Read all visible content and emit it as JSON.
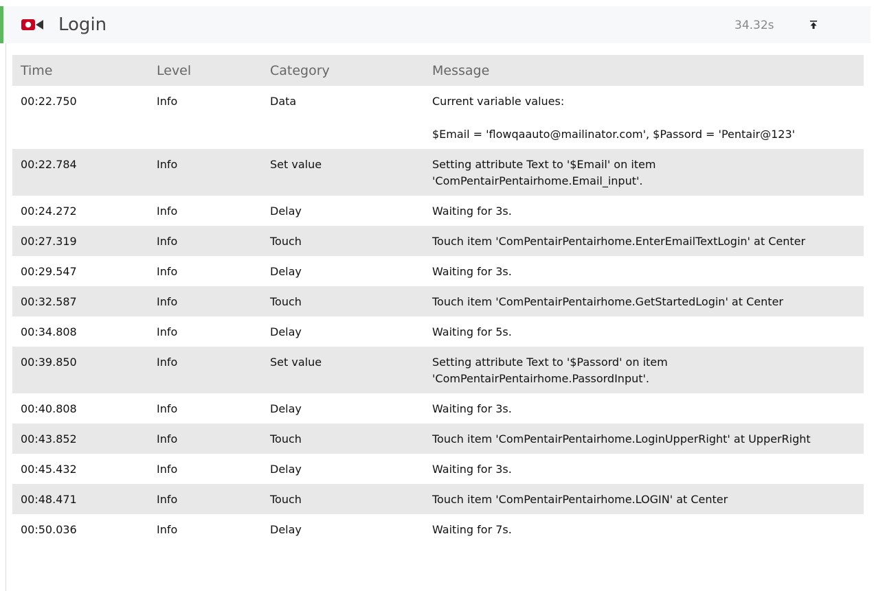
{
  "header": {
    "icon": "video-record-icon",
    "title": "Login",
    "duration": "34.32s",
    "scroll_top_icon": "scroll-to-top-icon",
    "accent_color": "#5cb85c",
    "record_color": "#c9001f"
  },
  "table": {
    "columns": [
      "Time",
      "Level",
      "Category",
      "Message"
    ],
    "rows": [
      {
        "time": "00:22.750",
        "level": "Info",
        "category": "Data",
        "message": "Current variable values:",
        "message_extra": "$Email = 'flowqaauto@mailinator.com', $Passord = 'Pentair@123'"
      },
      {
        "time": "00:22.784",
        "level": "Info",
        "category": "Set value",
        "message": "Setting attribute Text to '$Email' on item 'ComPentairPentairhome.Email_input'."
      },
      {
        "time": "00:24.272",
        "level": "Info",
        "category": "Delay",
        "message": "Waiting for 3s."
      },
      {
        "time": "00:27.319",
        "level": "Info",
        "category": "Touch",
        "message": "Touch item 'ComPentairPentairhome.EnterEmailTextLogin' at Center"
      },
      {
        "time": "00:29.547",
        "level": "Info",
        "category": "Delay",
        "message": "Waiting for 3s."
      },
      {
        "time": "00:32.587",
        "level": "Info",
        "category": "Touch",
        "message": "Touch item 'ComPentairPentairhome.GetStartedLogin' at Center"
      },
      {
        "time": "00:34.808",
        "level": "Info",
        "category": "Delay",
        "message": "Waiting for 5s."
      },
      {
        "time": "00:39.850",
        "level": "Info",
        "category": "Set value",
        "message": "Setting attribute Text to '$Passord' on item 'ComPentairPentairhome.PassordInput'."
      },
      {
        "time": "00:40.808",
        "level": "Info",
        "category": "Delay",
        "message": "Waiting for 3s."
      },
      {
        "time": "00:43.852",
        "level": "Info",
        "category": "Touch",
        "message": "Touch item 'ComPentairPentairhome.LoginUpperRight' at UpperRight"
      },
      {
        "time": "00:45.432",
        "level": "Info",
        "category": "Delay",
        "message": "Waiting for 3s."
      },
      {
        "time": "00:48.471",
        "level": "Info",
        "category": "Touch",
        "message": "Touch item 'ComPentairPentairhome.LOGIN' at Center"
      },
      {
        "time": "00:50.036",
        "level": "Info",
        "category": "Delay",
        "message": "Waiting for 7s."
      }
    ]
  }
}
